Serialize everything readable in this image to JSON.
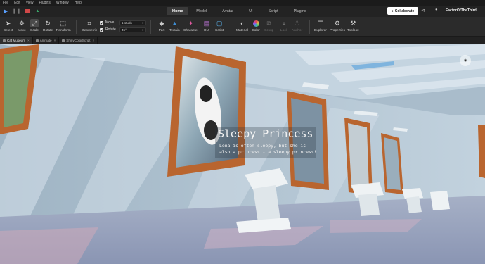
{
  "menubar": {
    "items": [
      "File",
      "Edit",
      "View",
      "Plugins",
      "Window",
      "Help"
    ]
  },
  "topbar": {
    "tabs": [
      {
        "label": "Home",
        "active": true
      },
      {
        "label": "Model",
        "active": false
      },
      {
        "label": "Avatar",
        "active": false
      },
      {
        "label": "UI",
        "active": false
      },
      {
        "label": "Script",
        "active": false
      },
      {
        "label": "Plugins",
        "active": false
      }
    ],
    "add_tab": "+",
    "collaborate_label": "Collaborate",
    "username": "FactorOfTheThird"
  },
  "toolbar": {
    "select": "Select",
    "move": "Move",
    "scale": "Scale",
    "rotate": "Rotate",
    "transform": "Transform",
    "geometric": "Geometric",
    "snap_move_label": "Move",
    "snap_move_value": "1 studs",
    "snap_rotate_label": "Rotate",
    "snap_rotate_value": "45°",
    "part": "Part",
    "terrain": "Terrain",
    "character": "Character",
    "gui": "GUI",
    "script": "Script",
    "material": "Material",
    "color": "Color",
    "group": "Group",
    "lock": "Lock",
    "anchor": "Anchor",
    "explorer": "Explorer",
    "properties": "Properties",
    "toolbox": "Toolbox"
  },
  "doctabs": [
    {
      "label": "Cat Museum",
      "active": true
    },
    {
      "label": "Animate",
      "active": false
    },
    {
      "label": "ShinyColorScript",
      "active": false
    }
  ],
  "viewport": {
    "sign_title": "Sleepy Princess",
    "sign_description": "Lena is often sleepy, but she is also a princess - a sleepy princess!"
  },
  "colors": {
    "collaborate_bg": "#ffffff",
    "active_tab_bg": "#3a3a3a",
    "frame_wood": "#b9652f",
    "wall": "#a9bccb",
    "floor_carpet": "#8f9bb8"
  }
}
